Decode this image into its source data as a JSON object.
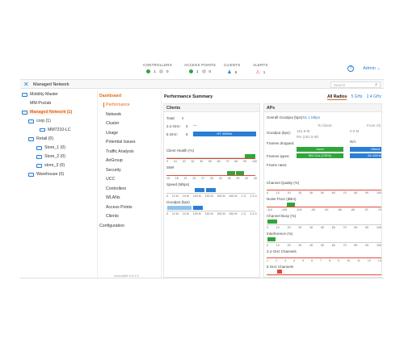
{
  "topbar": {
    "stats": [
      {
        "label": "CONTROLLERS",
        "values": [
          "1",
          "0"
        ]
      },
      {
        "label": "ACCESS POINTS",
        "values": [
          "1",
          "0"
        ]
      },
      {
        "label": "CLIENTS",
        "values": [
          "6"
        ]
      },
      {
        "label": "ALERTS",
        "values": [
          "1"
        ]
      }
    ],
    "help": "?",
    "user": "Admin ⌄"
  },
  "header": {
    "title": "Managed Network",
    "search_placeholder": "Search"
  },
  "tree": [
    {
      "label": "Mobility Master",
      "type": "folder"
    },
    {
      "label": "MM-Poclab",
      "type": "text"
    },
    {
      "label": "Managed Network (1)",
      "type": "folder",
      "selected": true
    },
    {
      "label": "corp (1)",
      "type": "folder"
    },
    {
      "label": "MM7210-LC",
      "type": "host"
    },
    {
      "label": "Retail (0)",
      "type": "folder"
    },
    {
      "label": "Store_1 (0)",
      "type": "folder"
    },
    {
      "label": "Store_2 (0)",
      "type": "folder"
    },
    {
      "label": "store_3 (0)",
      "type": "folder"
    },
    {
      "label": "Warehouse (0)",
      "type": "folder"
    }
  ],
  "menu": {
    "heading": "Dashboard",
    "items": [
      "Performance",
      "Network",
      "Cluster",
      "Usage",
      "Potential Issues",
      "Traffic Analysis",
      "AirGroup",
      "Security",
      "UCC",
      "Controllers",
      "WLANs",
      "Access Points",
      "Clients"
    ],
    "configuration": "Configuration",
    "footer": "ArubaMM 8.0.0.0"
  },
  "content": {
    "title": "Performance Summary",
    "radios": [
      "All Radios",
      "5 GHz",
      "2.4 GHz"
    ],
    "clients": {
      "title": "Clients",
      "total_label": "Total:",
      "total_value": "6",
      "band24_label": "2.4 GHz:",
      "band24_value": "0",
      "band5_label": "5 GHz:",
      "band5_value": "6",
      "ht_label": "HT 40MHz",
      "health_label": "Client Health (%)",
      "health_axis": [
        "0",
        "10",
        "20",
        "30",
        "40",
        "50",
        "60",
        "70",
        "80",
        "90",
        "100"
      ],
      "snr_label": "SNR",
      "snr_axis": [
        "15",
        "18",
        "21",
        "24",
        "27",
        "30",
        "33",
        "36",
        "39",
        "42",
        "45"
      ],
      "speed_label": "Speed (Mbps)",
      "speed_axis": [
        "0",
        "12 M",
        "24 M",
        "100 M",
        "150 M",
        "300 M",
        "450 M",
        "1 G",
        "1.3 G"
      ],
      "goodput_label": "Goodput (bps)",
      "goodput_axis": [
        "0",
        "12 M",
        "24 M",
        "100 M",
        "150 M",
        "300 M",
        "450 M",
        "1 G",
        "1.3 G"
      ]
    },
    "aps": {
      "title": "APs",
      "overall_label": "Overall Goodput (bps):",
      "overall_value": "51.1 Mbps",
      "to_client": "To Client",
      "from_client": "From Cli",
      "goodput_label": "Goodput (bps):",
      "goodput_v1": "151.9 M",
      "goodput_v2": "0.0 M",
      "pct_line": "0% (151.9 M)",
      "dropped_label": "Frames dropped:",
      "dropped_v": "N/A",
      "used_label": "Used",
      "mixed_label": "Mixed",
      "types_label": "Frames types:",
      "types_v1": "802.11a (100%)",
      "types_v2": "54-108 M",
      "rates_label": "Frame rates:",
      "chq_label": "Channel Quality (%)",
      "noise_label": "Noise Floor (dBm)",
      "busy_label": "Channel Busy (%)",
      "intf_label": "Interference (%)",
      "ch24_label": "2.4 GHz Channels",
      "ch5_label": "5 GHz Channels",
      "pct_axis": [
        "0",
        "10",
        "20",
        "30",
        "40",
        "50",
        "60",
        "70",
        "80",
        "90",
        "100"
      ],
      "noise_axis": [
        "-110",
        "-105",
        "-100",
        "-95",
        "-90",
        "-85",
        "-80",
        "-75",
        "-70"
      ],
      "ch24_axis": [
        "1",
        "2",
        "3",
        "4",
        "5",
        "6",
        "7",
        "8",
        "9",
        "10",
        "11",
        "12",
        "13"
      ]
    }
  },
  "colors": {
    "accent": "#e06a17",
    "link": "#2a7fd4",
    "good": "#2fa53a",
    "alert": "#e04a3a",
    "blue": "#2a7fd4"
  }
}
